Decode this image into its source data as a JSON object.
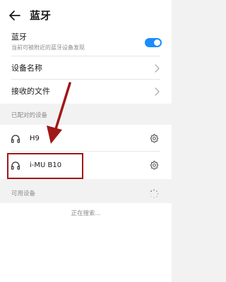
{
  "header": {
    "title": "蓝牙"
  },
  "bluetooth": {
    "label": "蓝牙",
    "description": "当前可被附近的蓝牙设备发现",
    "enabled": true
  },
  "settings": {
    "device_name_label": "设备名称",
    "received_files_label": "接收的文件"
  },
  "paired": {
    "section_label": "已配对的设备",
    "devices": [
      {
        "name": "H9"
      },
      {
        "name": "i-MU B10"
      }
    ]
  },
  "available": {
    "section_label": "可用设备",
    "status": "正在搜索..."
  },
  "colors": {
    "accent": "#1a8cff",
    "annotation": "#a01818"
  }
}
